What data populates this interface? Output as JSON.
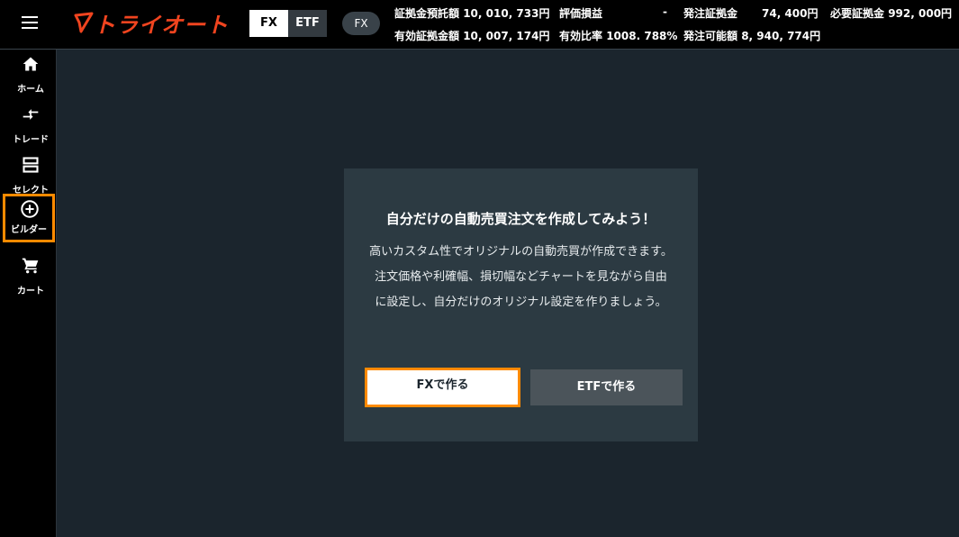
{
  "app": {
    "logo_text": "トライオート"
  },
  "header": {
    "segment": [
      "FX",
      "ETF"
    ],
    "pill": "FX",
    "stats": [
      {
        "label": "証拠金預託額",
        "value": "10, 010, 733円"
      },
      {
        "label": "評価損益",
        "value": "-"
      },
      {
        "label": "発注証拠金",
        "value": "74, 400円"
      },
      {
        "label": "必要証拠金",
        "value": "992, 000円"
      },
      {
        "label": "有効証拠金額",
        "value": "10, 007, 174円"
      },
      {
        "label": "有効比率",
        "value": "1008. 788%"
      },
      {
        "label": "発注可能額",
        "value": "8, 940, 774円"
      }
    ]
  },
  "sidebar": {
    "items": [
      {
        "label": "ホーム",
        "icon": "home-icon"
      },
      {
        "label": "トレード",
        "icon": "trade-arrows-icon"
      },
      {
        "label": "セレクト",
        "icon": "select-icon"
      },
      {
        "label": "ビルダー",
        "icon": "plus-circle-icon",
        "active": true
      },
      {
        "label": "カート",
        "icon": "cart-icon"
      }
    ]
  },
  "modal": {
    "title": "自分だけの自動売買注文を作成してみよう！",
    "body": "高いカスタム性でオリジナルの自動売買が作成できます。注文価格や利確幅、損切幅などチャートを見ながら自由に設定し、自分だけのオリジナル設定を作りましょう。",
    "fx_button": "FXで作る",
    "etf_button": "ETFで作る"
  },
  "colors": {
    "accent": "#ff8a00",
    "logo": "#f0441f",
    "bg": "#1b252d",
    "modal": "#2c3a42"
  }
}
